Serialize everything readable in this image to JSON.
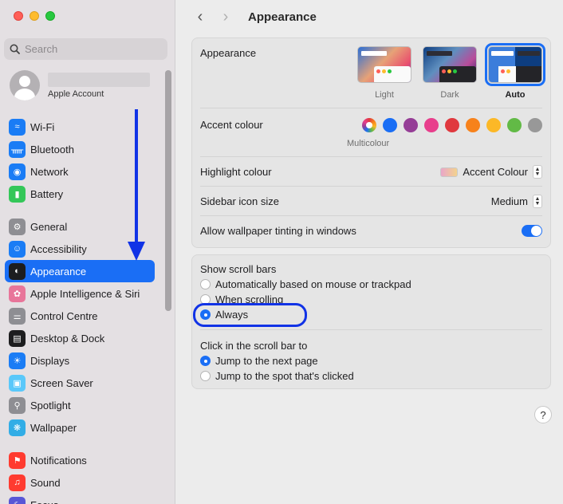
{
  "sidebar": {
    "search_placeholder": "Search",
    "account_label": "Apple Account",
    "items": [
      {
        "label": "Wi-Fi",
        "icon": "wifi-icon",
        "color": "#1a7cf5"
      },
      {
        "label": "Bluetooth",
        "icon": "bluetooth-icon",
        "color": "#1a7cf5"
      },
      {
        "label": "Network",
        "icon": "globe-icon",
        "color": "#1a7cf5"
      },
      {
        "label": "Battery",
        "icon": "battery-icon",
        "color": "#34c759"
      },
      {
        "label": "General",
        "icon": "gear-icon",
        "color": "#8e8e93"
      },
      {
        "label": "Accessibility",
        "icon": "accessibility-icon",
        "color": "#1a7cf5"
      },
      {
        "label": "Appearance",
        "icon": "appearance-icon",
        "color": "#1d1d1f"
      },
      {
        "label": "Apple Intelligence & Siri",
        "icon": "siri-icon",
        "color": "#e8759a"
      },
      {
        "label": "Control Centre",
        "icon": "control-centre-icon",
        "color": "#8e8e93"
      },
      {
        "label": "Desktop & Dock",
        "icon": "dock-icon",
        "color": "#1d1d1f"
      },
      {
        "label": "Displays",
        "icon": "sun-icon",
        "color": "#1a7cf5"
      },
      {
        "label": "Screen Saver",
        "icon": "screen-saver-icon",
        "color": "#5ac8fa"
      },
      {
        "label": "Spotlight",
        "icon": "magnifier-icon",
        "color": "#8e8e93"
      },
      {
        "label": "Wallpaper",
        "icon": "wallpaper-icon",
        "color": "#32ade6"
      },
      {
        "label": "Notifications",
        "icon": "bell-icon",
        "color": "#ff3b30"
      },
      {
        "label": "Sound",
        "icon": "speaker-icon",
        "color": "#ff3b30"
      },
      {
        "label": "Focus",
        "icon": "moon-icon",
        "color": "#5856d6"
      }
    ]
  },
  "header": {
    "title": "Appearance"
  },
  "appearance": {
    "label": "Appearance",
    "options": [
      {
        "label": "Light",
        "selected": false
      },
      {
        "label": "Dark",
        "selected": false
      },
      {
        "label": "Auto",
        "selected": true
      }
    ]
  },
  "accent": {
    "label": "Accent colour",
    "selected_label": "Multicolour",
    "colors": [
      "multicolour",
      "#1a6ef5",
      "#953d96",
      "#e83e8c",
      "#e0383e",
      "#f7821b",
      "#fcb827",
      "#62ba46",
      "#989898"
    ]
  },
  "highlight": {
    "label": "Highlight colour",
    "value": "Accent Colour"
  },
  "icon_size": {
    "label": "Sidebar icon size",
    "value": "Medium"
  },
  "tinting": {
    "label": "Allow wallpaper tinting in windows",
    "on": true
  },
  "scroll_bars": {
    "label": "Show scroll bars",
    "options": [
      {
        "label": "Automatically based on mouse or trackpad",
        "selected": false
      },
      {
        "label": "When scrolling",
        "selected": false
      },
      {
        "label": "Always",
        "selected": true
      }
    ]
  },
  "click_scroll": {
    "label": "Click in the scroll bar to",
    "options": [
      {
        "label": "Jump to the next page",
        "selected": true
      },
      {
        "label": "Jump to the spot that's clicked",
        "selected": false
      }
    ]
  },
  "help_label": "?"
}
